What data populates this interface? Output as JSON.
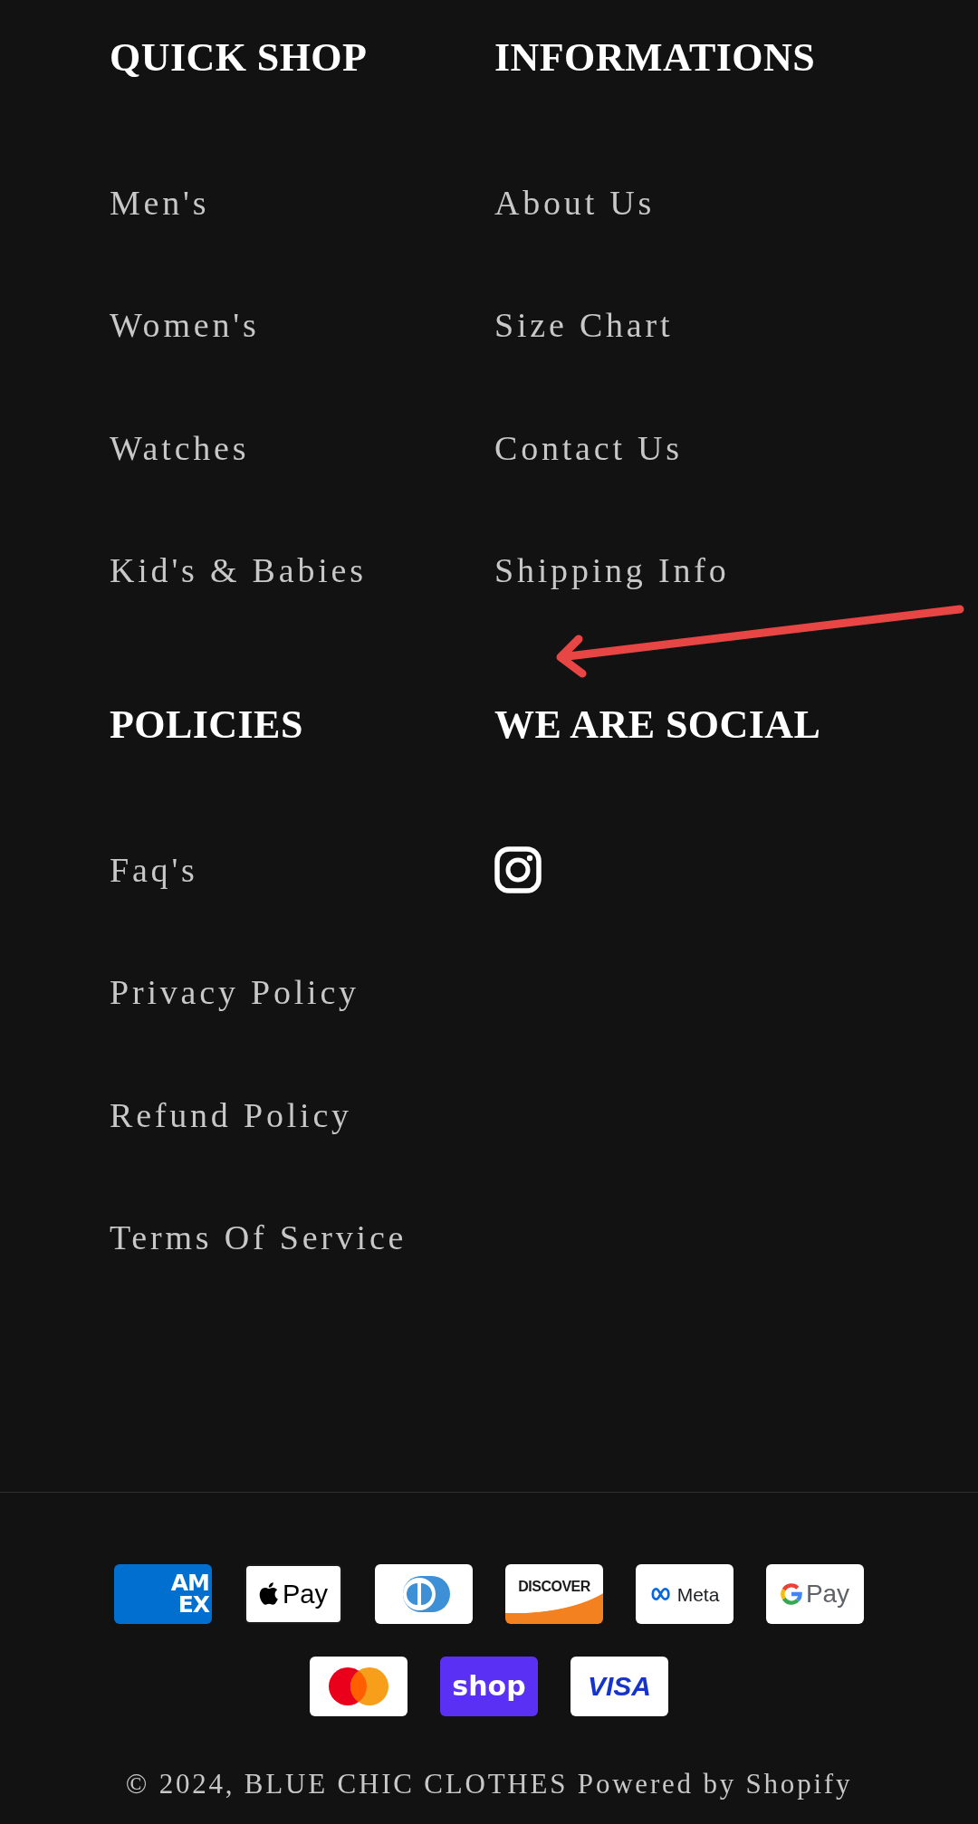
{
  "footer_columns": [
    {
      "heading": "QUICK SHOP",
      "links": [
        "Men's",
        "Women's",
        "Watches",
        "Kid's & Babies"
      ]
    },
    {
      "heading": "INFORMATIONS",
      "links": [
        "About Us",
        "Size Chart",
        "Contact Us",
        "Shipping Info"
      ]
    },
    {
      "heading": "POLICIES",
      "links": [
        "Faq's",
        "Privacy Policy",
        "Refund Policy",
        "Terms Of Service"
      ]
    },
    {
      "heading": "WE ARE SOCIAL",
      "social_links": [
        {
          "kind": "instagram"
        }
      ]
    }
  ],
  "payment_methods": [
    {
      "kind": "amex",
      "lines": [
        "AM",
        "EX"
      ]
    },
    {
      "kind": "apple_pay",
      "text": "Pay"
    },
    {
      "kind": "diners"
    },
    {
      "kind": "discover",
      "text": "DISCOVER"
    },
    {
      "kind": "meta",
      "text": "Meta"
    },
    {
      "kind": "google_pay",
      "text": "Pay"
    },
    {
      "kind": "mastercard"
    },
    {
      "kind": "shop_pay",
      "text": "shop"
    },
    {
      "kind": "visa",
      "text": "VISA"
    }
  ],
  "copyright": "© 2024, BLUE CHIC CLOTHES",
  "powered_by": "Powered by Shopify"
}
